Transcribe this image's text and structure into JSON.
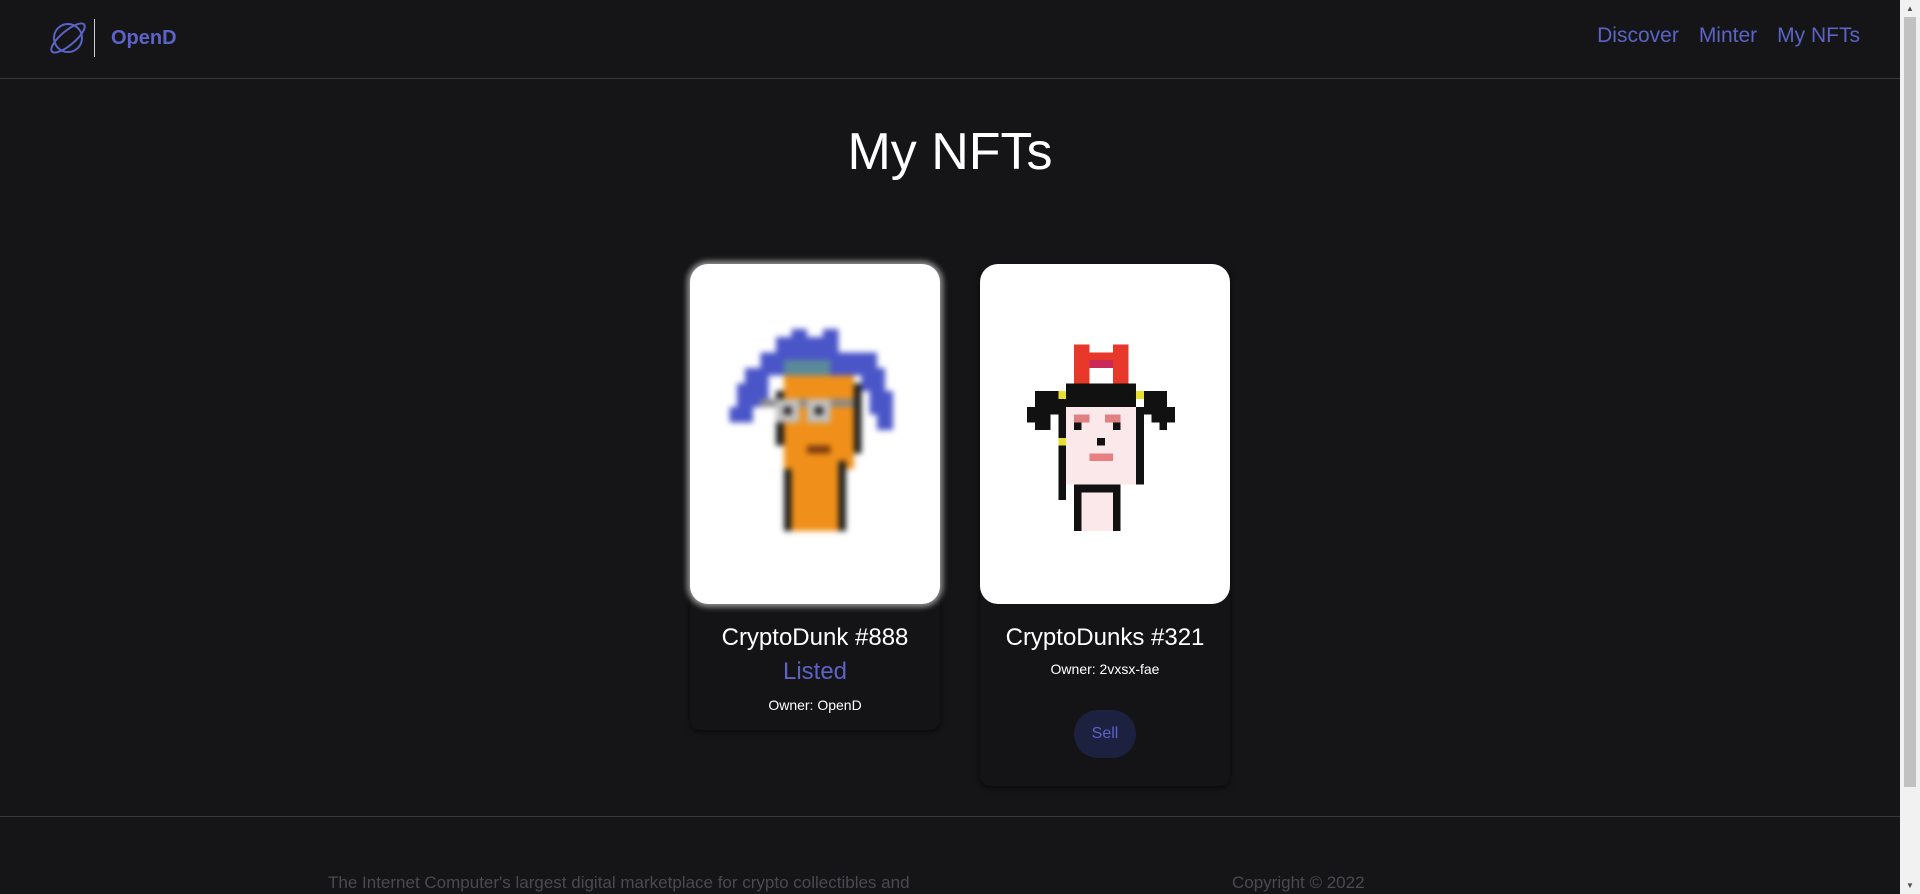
{
  "header": {
    "brand": "OpenD",
    "logo_icon": "planet-icon",
    "nav": [
      "Discover",
      "Minter",
      "My NFTs"
    ]
  },
  "page": {
    "title": "My NFTs"
  },
  "nfts": [
    {
      "name": "CryptoDunk #888",
      "status": "Listed",
      "owner": "Owner: OpenD",
      "image": "pixel-punk-blue-hair-orange-face"
    },
    {
      "name": "CryptoDunks #321",
      "owner": "Owner: 2vxsx-fae",
      "sell_label": "Sell",
      "image": "pixel-punk-red-bow-pale-face"
    }
  ],
  "footer": {
    "description": "The Internet Computer's largest digital marketplace for crypto collectibles and",
    "copyright": "Copyright © 2022"
  },
  "colors": {
    "background": "#151517",
    "accent": "#5b63c6",
    "sell_bg": "#1d2140"
  }
}
